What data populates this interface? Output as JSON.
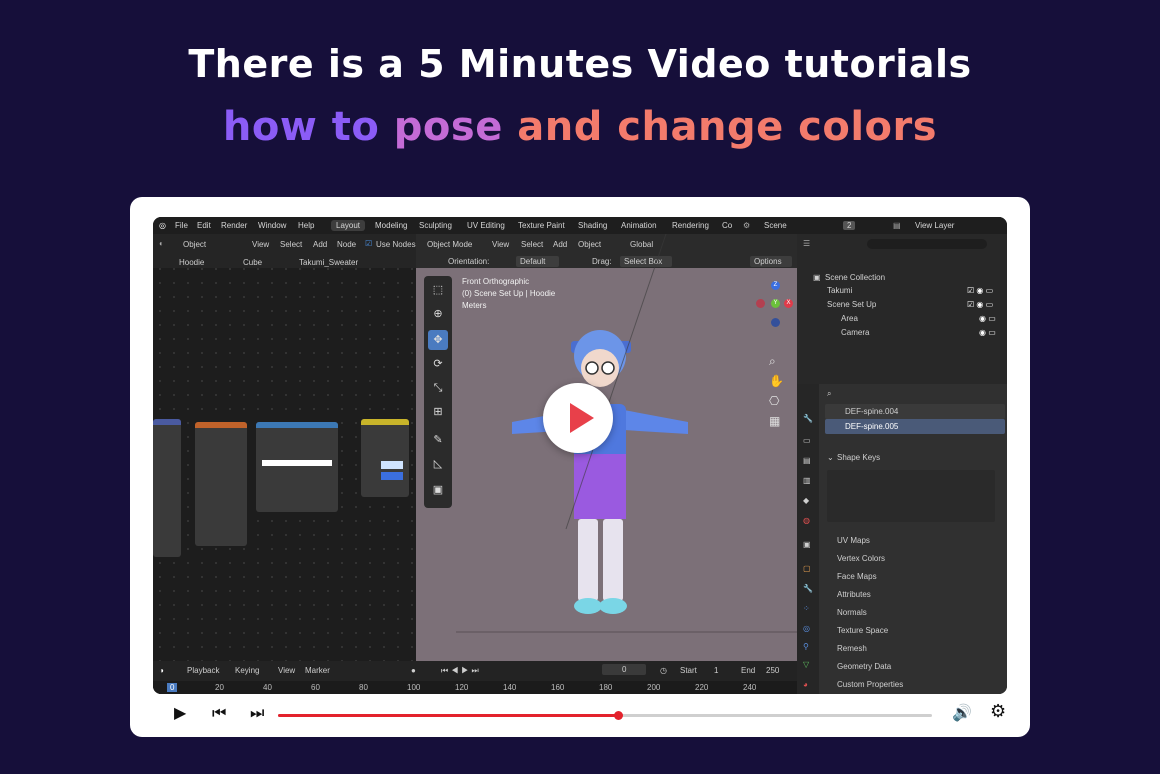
{
  "headline": {
    "line1": "There is a 5 Minutes Video tutorials",
    "line2_a": "how to",
    "line2_b": "pose",
    "line2_c": "and change colors"
  },
  "colors": {
    "accent_red": "#e3222c",
    "bg": "#160f3a",
    "purple": "#8b5cf6",
    "coral": "#f37b6c"
  },
  "blender": {
    "menu": [
      "File",
      "Edit",
      "Render",
      "Window",
      "Help"
    ],
    "workspaces": [
      "Layout",
      "Modeling",
      "Sculpting",
      "UV Editing",
      "Texture Paint",
      "Shading",
      "Animation",
      "Rendering",
      "Co"
    ],
    "scene_label": "Scene",
    "scene_count": "2",
    "view_layer": "View Layer",
    "node_editor": {
      "mode": "Object",
      "menus": [
        "View",
        "Select",
        "Add",
        "Node"
      ],
      "use_nodes": "Use Nodes",
      "breadcrumb": [
        "Hoodie",
        "Cube",
        "Takumi_Sweater"
      ]
    },
    "viewport": {
      "mode": "Object Mode",
      "menus": [
        "View",
        "Select",
        "Add",
        "Object"
      ],
      "orientation_label": "Orientation:",
      "orientation_value": "Default",
      "drag_label": "Drag:",
      "drag_value": "Select Box",
      "options": "Options",
      "global": "Global",
      "overlay_lines": [
        "Front Orthographic",
        "(0) Scene Set Up | Hoodie",
        "Meters"
      ]
    },
    "outliner": {
      "root": "Scene Collection",
      "items": [
        "Takumi",
        "Scene Set Up",
        "Area",
        "Camera"
      ]
    },
    "properties": {
      "bones": [
        "DEF-spine.004",
        "DEF-spine.005"
      ],
      "shape_keys": "Shape Keys",
      "panels": [
        "UV Maps",
        "Vertex Colors",
        "Face Maps",
        "Attributes",
        "Normals",
        "Texture Space",
        "Remesh",
        "Geometry Data",
        "Custom Properties"
      ]
    },
    "timeline": {
      "menus": [
        "Playback",
        "Keying",
        "View",
        "Marker"
      ],
      "current_frame": "0",
      "start_label": "Start",
      "start_value": "1",
      "end_label": "End",
      "end_value": "250",
      "ticks": [
        "0",
        "20",
        "40",
        "60",
        "80",
        "100",
        "120",
        "140",
        "160",
        "180",
        "200",
        "220",
        "240"
      ]
    }
  },
  "player": {
    "progress": 0.52,
    "icons": [
      "play-icon",
      "skip-back-icon",
      "skip-forward-icon",
      "volume-icon",
      "settings-icon"
    ]
  }
}
